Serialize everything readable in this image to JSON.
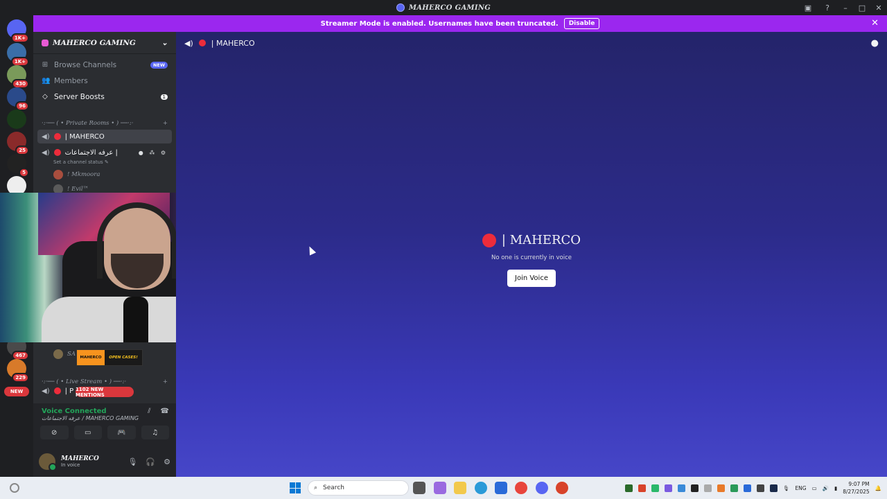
{
  "window": {
    "title": "MAHERCO GAMING"
  },
  "banner": {
    "text": "Streamer Mode is enabled. Usernames have been truncated.",
    "button": "Disable"
  },
  "server_rail": {
    "items": [
      {
        "badge": "1K+",
        "color": "#5865f2"
      },
      {
        "badge": "1K+",
        "color": "#3a6ea8"
      },
      {
        "badge": "430",
        "color": "#7a9a5a"
      },
      {
        "badge": "96",
        "color": "#2a4a8a"
      },
      {
        "badge": "",
        "color": "#1a3a1a"
      },
      {
        "badge": "25",
        "color": "#8a2a2a"
      },
      {
        "badge": "5",
        "color": "#222222"
      },
      {
        "badge": "",
        "color": "#eeeeee"
      },
      {
        "badge": "467",
        "color": "#4a4a4a"
      },
      {
        "badge": "229",
        "color": "#d87a2a"
      }
    ],
    "new_label": "NEW"
  },
  "sidebar": {
    "server_name": "MAHERCO GAMING",
    "nav": [
      {
        "label": "Browse Channels",
        "tag": "NEW"
      },
      {
        "label": "Members"
      },
      {
        "label": "Server Boosts",
        "count": "1"
      }
    ],
    "category1": "·:·── ( • Private Rooms • ) ──·:·",
    "channels": [
      {
        "name": "| MAHERCO",
        "active": true
      },
      {
        "name": "عرفه الاجتماعات |"
      }
    ],
    "channel_status": "Set a channel status",
    "voice_users": [
      "! Mkmoora",
      "! Evil™"
    ],
    "partial_user": "SA",
    "case_ad": {
      "left": "MAHERCO",
      "right": "OPEN CASES!"
    },
    "category2": "·:·── ( • Live Stream • ) ──·:·",
    "partial_channel": "| P",
    "mentions": "1102 NEW MENTIONS"
  },
  "voice_panel": {
    "title": "Voice Connected",
    "subtitle": "عرفه الاجتماعات / MAHERCO GAMING"
  },
  "user_panel": {
    "name": "MAHERCO",
    "status": "In voice"
  },
  "main": {
    "channel": "| MAHERCO",
    "center_title": "| MAHERCO",
    "center_sub": "No one is currently in voice",
    "join_button": "Join Voice"
  },
  "taskbar": {
    "search_placeholder": "Search",
    "lang": "ENG",
    "time": "9:07 PM",
    "date": "8/27/2025"
  }
}
